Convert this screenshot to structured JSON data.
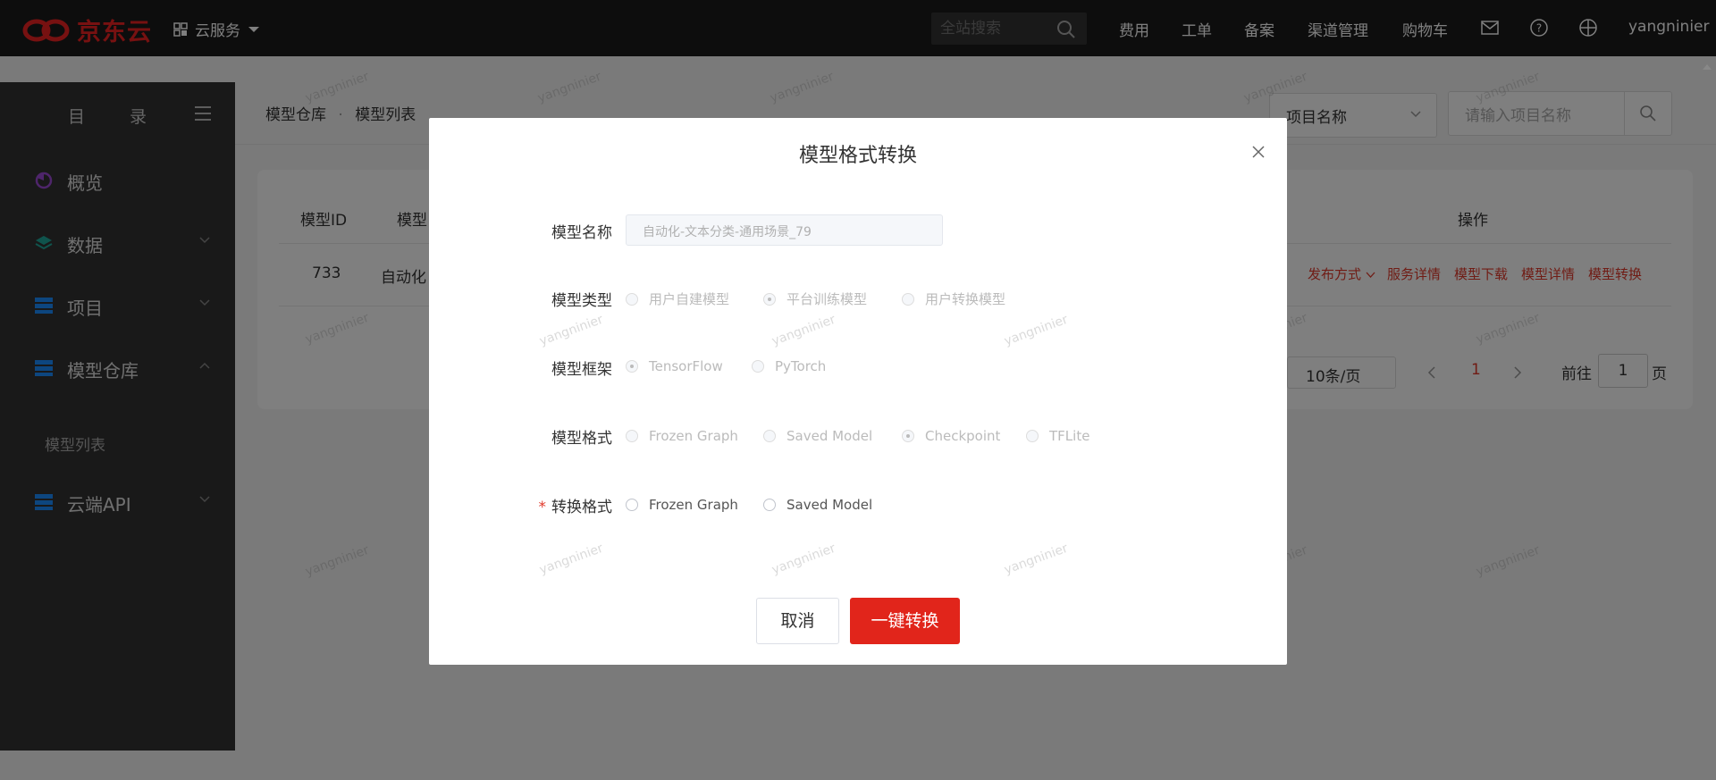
{
  "topbar": {
    "logo_text": "京东云",
    "cloud_services": "云服务",
    "search_placeholder": "全站搜索",
    "nav": [
      "费用",
      "工单",
      "备案",
      "渠道管理",
      "购物车"
    ],
    "username": "yangninier"
  },
  "sidebar": {
    "title": "目 录",
    "items": [
      {
        "label": "概览",
        "icon": "pie-chart-icon",
        "icon_color": "#9c4bd6"
      },
      {
        "label": "数据",
        "icon": "layers-icon",
        "icon_color": "#1fa89a"
      },
      {
        "label": "项目",
        "icon": "server-icon",
        "icon_color": "#1a8cff"
      },
      {
        "label": "模型仓库",
        "icon": "server-icon",
        "icon_color": "#1a8cff"
      },
      {
        "label": "云端API",
        "icon": "server-icon",
        "icon_color": "#1a8cff"
      }
    ],
    "sub_item": "模型列表"
  },
  "main": {
    "breadcrumb": [
      "模型仓库",
      "模型列表"
    ],
    "breadcrumb_sep": "·",
    "project_select": "项目名称",
    "project_input_placeholder": "请输入项目名称",
    "table": {
      "headers": [
        "模型ID",
        "模型",
        "操作"
      ],
      "rows": [
        {
          "id": "733",
          "name": "自动化"
        }
      ],
      "actions": [
        "发布方式",
        "服务详情",
        "模型下载",
        "模型详情",
        "模型转换"
      ]
    },
    "pager": {
      "page_size": "10条/页",
      "current_page": "1",
      "goto_label": "前往",
      "goto_value": "1",
      "page_suffix": "页"
    }
  },
  "watermark": "yangninier",
  "modal": {
    "title": "模型格式转换",
    "fields": {
      "name": {
        "label": "模型名称",
        "value": "自动化-文本分类-通用场景_79"
      },
      "type": {
        "label": "模型类型",
        "options": [
          "用户自建模型",
          "平台训练模型",
          "用户转换模型"
        ],
        "selected": "平台训练模型"
      },
      "framework": {
        "label": "模型框架",
        "options": [
          "TensorFlow",
          "PyTorch"
        ],
        "selected": "TensorFlow"
      },
      "format": {
        "label": "模型格式",
        "options": [
          "Frozen Graph",
          "Saved Model",
          "Checkpoint",
          "TFLite"
        ],
        "selected": "Checkpoint"
      },
      "convert": {
        "label": "转换格式",
        "required_mark": "*",
        "options": [
          "Frozen Graph",
          "Saved Model"
        ],
        "selected": ""
      }
    },
    "cancel_label": "取消",
    "convert_label": "一键转换"
  },
  "colors": {
    "accent": "#e1251b",
    "topbar": "#1a1a1a",
    "sidebar": "#333333"
  }
}
